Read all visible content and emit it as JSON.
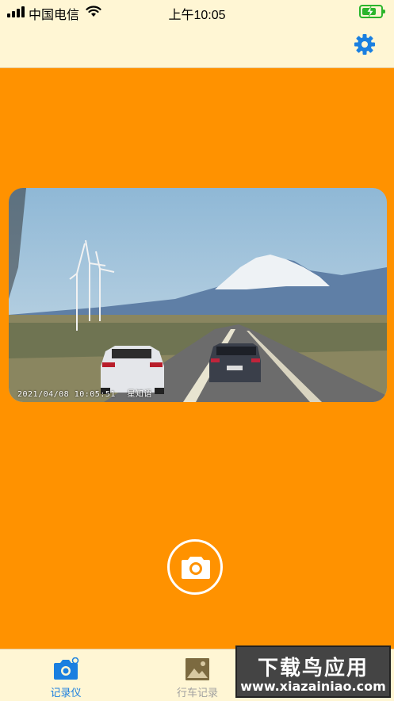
{
  "status_bar": {
    "carrier": "中国电信",
    "time": "上午10:05",
    "battery_state": "charging",
    "battery_color": "#2bb52b"
  },
  "nav": {
    "settings_icon": "gear-icon",
    "accent_color": "#1a7fe0"
  },
  "preview": {
    "timestamp": "2021/04/08  10:05:51",
    "overlay_label": "星知语"
  },
  "capture": {
    "icon": "camera-icon"
  },
  "tabs": [
    {
      "label": "记录仪",
      "icon": "camera-icon",
      "active": true
    },
    {
      "label": "行车记录",
      "icon": "image-icon",
      "active": false
    }
  ],
  "watermark": {
    "main": "下载鸟应用",
    "sub": "www.xiazainiao.com"
  },
  "colors": {
    "background": "#ff9200",
    "bars": "#fff6d4",
    "tab_inactive": "#a0a0a0"
  }
}
